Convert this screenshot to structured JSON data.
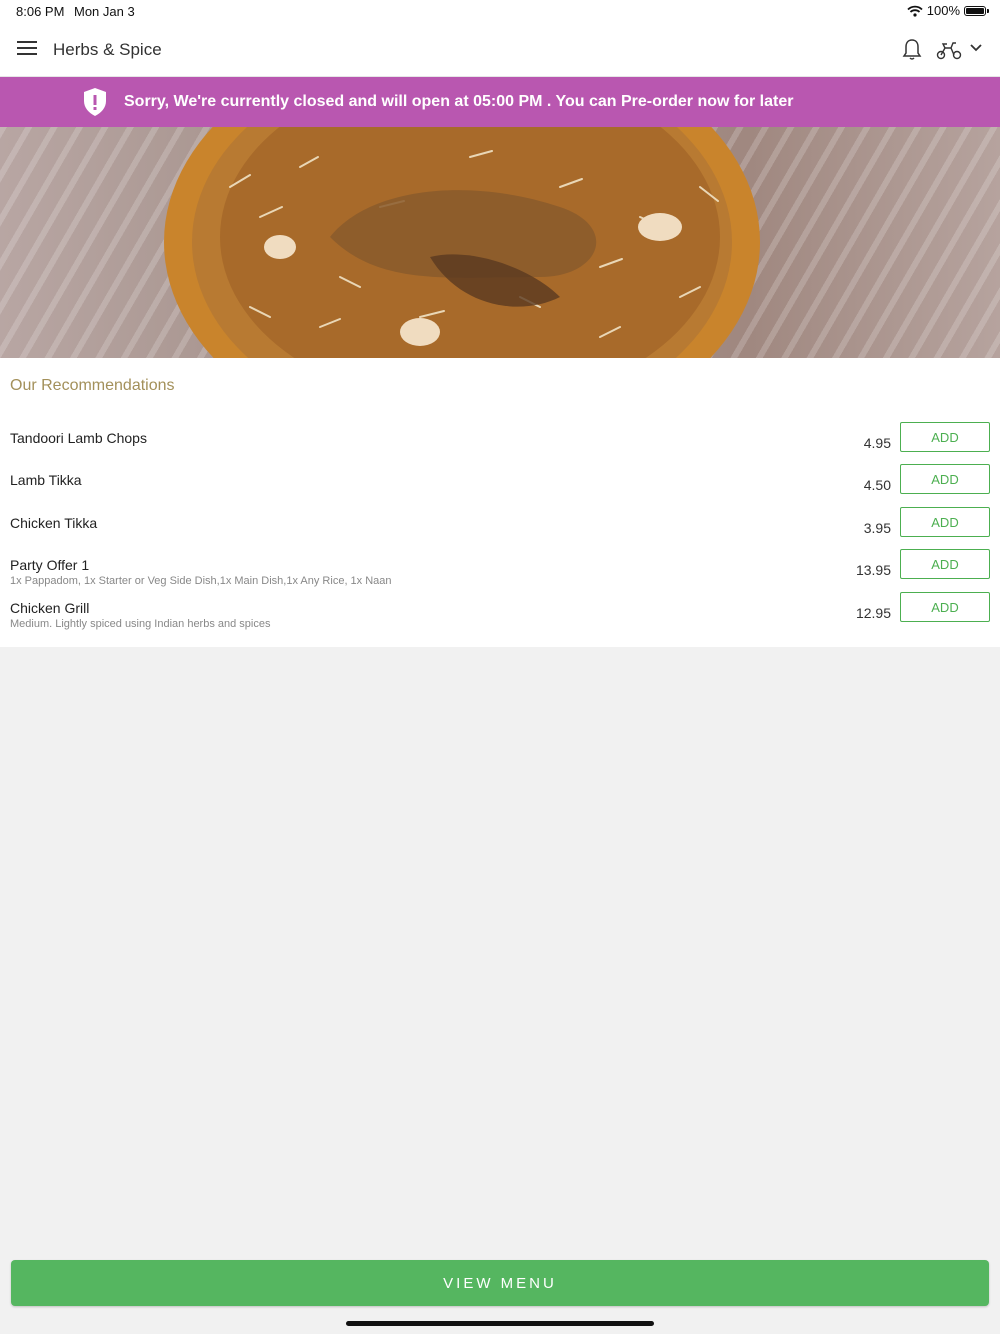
{
  "status_bar": {
    "time": "8:06 PM",
    "date": "Mon Jan 3",
    "battery": "100%"
  },
  "header": {
    "title": "Herbs & Spice"
  },
  "banner": {
    "message": "Sorry, We're currently closed and will open at 05:00 PM . You can Pre-order now for later"
  },
  "recommendations": {
    "title": "Our Recommendations",
    "items": [
      {
        "name": "Tandoori Lamb Chops",
        "description": "",
        "price": "4.95",
        "button": "ADD"
      },
      {
        "name": "Lamb Tikka",
        "description": "",
        "price": "4.50",
        "button": "ADD"
      },
      {
        "name": "Chicken Tikka",
        "description": "",
        "price": "3.95",
        "button": "ADD"
      },
      {
        "name": "Party Offer 1",
        "description": "1x Pappadom, 1x Starter or Veg Side Dish,1x Main Dish,1x Any Rice, 1x Naan",
        "price": "13.95",
        "button": "ADD"
      },
      {
        "name": "Chicken Grill",
        "description": "Medium. Lightly spiced using Indian herbs and spices",
        "price": "12.95",
        "button": "ADD"
      }
    ]
  },
  "footer": {
    "button": "VIEW MENU"
  },
  "colors": {
    "banner": "#b957b0",
    "accent_green": "#55b660",
    "section_title": "#a3905a"
  },
  "icons": [
    "menu-icon",
    "bell-icon",
    "scooter-icon",
    "chevron-down-icon",
    "shield-alert-icon",
    "wifi-icon",
    "battery-icon"
  ]
}
